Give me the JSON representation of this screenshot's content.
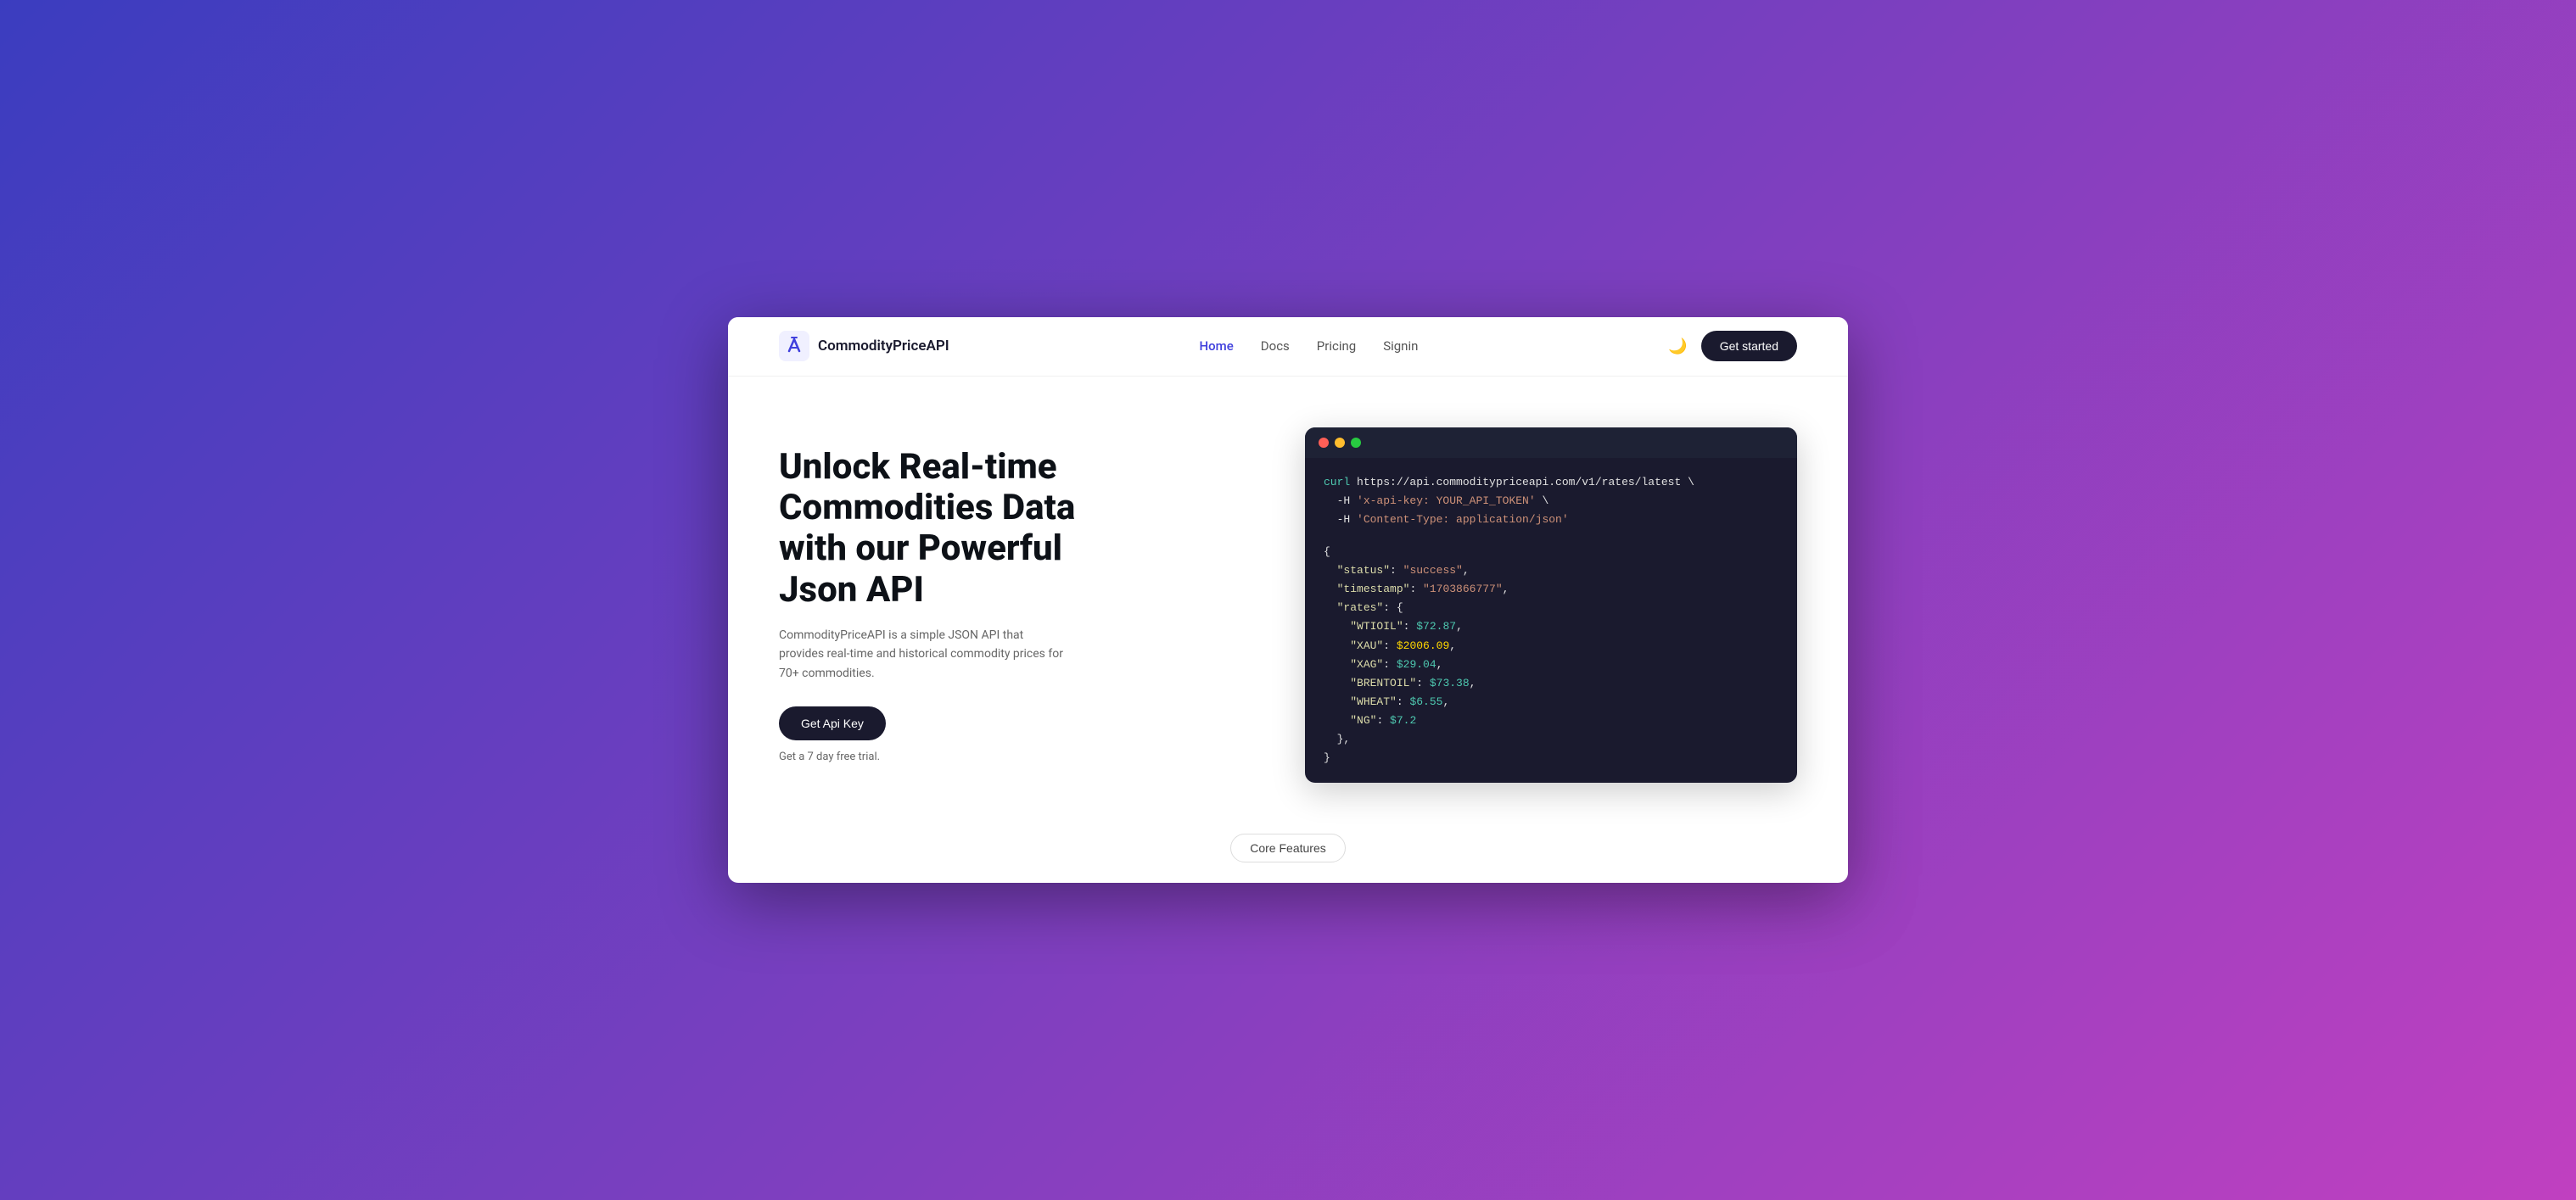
{
  "brand": {
    "name": "CommodityPriceAPI"
  },
  "navbar": {
    "links": [
      {
        "label": "Home",
        "active": true
      },
      {
        "label": "Docs",
        "active": false
      },
      {
        "label": "Pricing",
        "active": false
      },
      {
        "label": "Signin",
        "active": false
      }
    ],
    "cta": "Get started"
  },
  "hero": {
    "title": "Unlock Real-time Commodities Data  with our Powerful Json API",
    "description": "CommodityPriceAPI is a simple JSON API that provides real-time and historical commodity prices for 70+ commodities.",
    "cta_button": "Get Api Key",
    "trial_text": "Get a 7 day free trial."
  },
  "code": {
    "curl_line": "curl https://api.commoditypriceapi.com/v1/rates/latest \\",
    "header1": "-H 'x-api-key: YOUR_API_TOKEN' \\",
    "header2": "-H 'Content-Type: application/json'",
    "json": {
      "status": "\"success\"",
      "timestamp": "\"1703866777\"",
      "rates_open": "\"rates\": {",
      "wtioil": "\"WTIOIL\": $72.87,",
      "xau": "\"XAU\": $2006.09,",
      "xag": "\"XAG\": $29.04,",
      "brentoil": "\"BRENTOIL\": $73.38,",
      "wheat": "\"WHEAT\": $6.55,",
      "ng": "\"NG\": $7.2",
      "rates_close": "},",
      "obj_close": "}"
    }
  },
  "bottom": {
    "badge_label": "Core Features"
  }
}
